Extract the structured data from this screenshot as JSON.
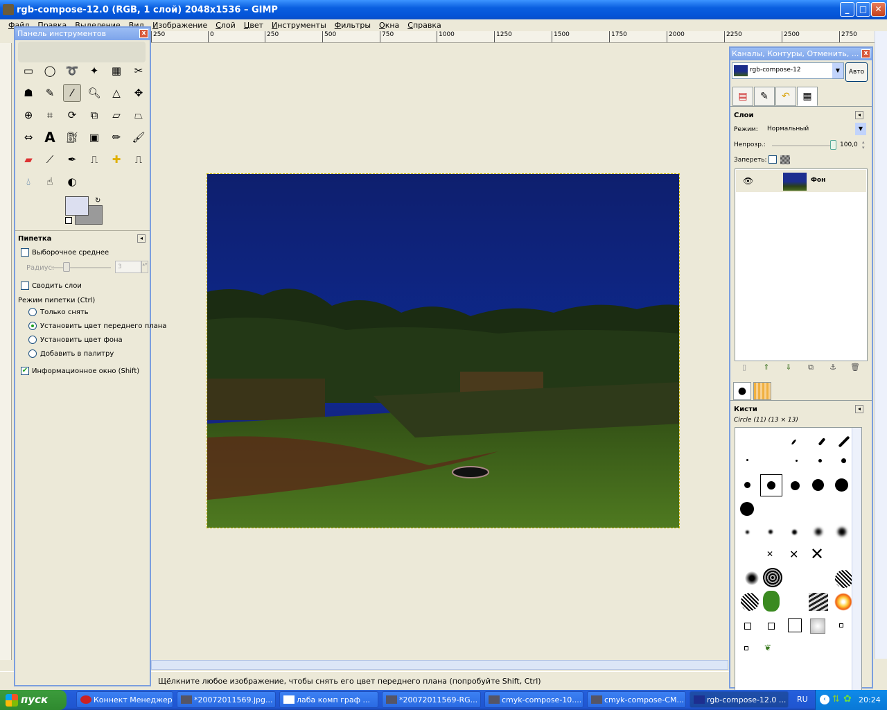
{
  "window": {
    "title": "rgb-compose-12.0 (RGB, 1 слой) 2048x1536 – GIMP",
    "minimize": "_",
    "maximize": "□",
    "close": "✕"
  },
  "menu": [
    "Файл",
    "Правка",
    "Выделение",
    "Вид",
    "Изображение",
    "Слой",
    "Цвет",
    "Инструменты",
    "Фильтры",
    "Окна",
    "Справка"
  ],
  "ruler": {
    "ticks": [
      "250",
      "0",
      "250",
      "500",
      "750",
      "1000",
      "1250",
      "1500",
      "1750",
      "2000",
      "2250",
      "2500",
      "2750"
    ]
  },
  "toolbox": {
    "title": "Панель инструментов",
    "tools": [
      "rect-select",
      "ellipse-select",
      "free-select",
      "fuzzy-select",
      "color-select",
      "scissors",
      "foreground-select",
      "paths",
      "color-picker",
      "zoom",
      "measure",
      "move",
      "align",
      "crop",
      "rotate",
      "scale",
      "shear",
      "perspective",
      "flip",
      "text",
      "bucket-fill",
      "blend",
      "pencil",
      "paintbrush",
      "eraser",
      "airbrush",
      "ink",
      "clone",
      "heal",
      "perspective-clone",
      "blur",
      "smudge",
      "dodge-burn"
    ],
    "options": {
      "header": "Пипетка",
      "sample_average": "Выборочное среднее",
      "radius_label": "Радиус:",
      "radius_value": "3",
      "sample_merged": "Сводить слои",
      "mode_label": "Режим пипетки  (Ctrl)",
      "mode_pick_only": "Только снять",
      "mode_set_fg": "Установить цвет переднего плана",
      "mode_set_bg": "Установить цвет фона",
      "mode_add_palette": "Добавить в палитру",
      "info_window": "Информационное окно  (Shift)"
    }
  },
  "status": "Щёлкните любое изображение, чтобы снять его цвет переднего плана (попробуйте Shift, Ctrl)",
  "dock": {
    "title": "Каналы, Контуры, Отменить, ...",
    "image_select": "rgb-compose-12",
    "auto_button": "Авто",
    "layers_header": "Слои",
    "mode_label": "Режим:",
    "mode_value": "Нормальный",
    "opacity_label": "Непрозр.:",
    "opacity_value": "100,0",
    "lock_label": "Запереть:",
    "layer_name": "Фон",
    "brushes_header": "Кисти",
    "brush_name": "Circle (11) (13 × 13)"
  },
  "taskbar": {
    "start": "пуск",
    "tasks": [
      "Коннект Менеджер",
      "*20072011569.jpg...",
      "лаба комп граф ...",
      "*20072011569-RG...",
      "cmyk-compose-10....",
      "cmyk-compose-CM...",
      "rgb-compose-12.0 ..."
    ],
    "lang": "RU",
    "clock": "20:24"
  },
  "colors": {
    "accent": "#0a5fe0",
    "fg_color": "#dcdff0",
    "bg_color": "#9a9a9a"
  }
}
